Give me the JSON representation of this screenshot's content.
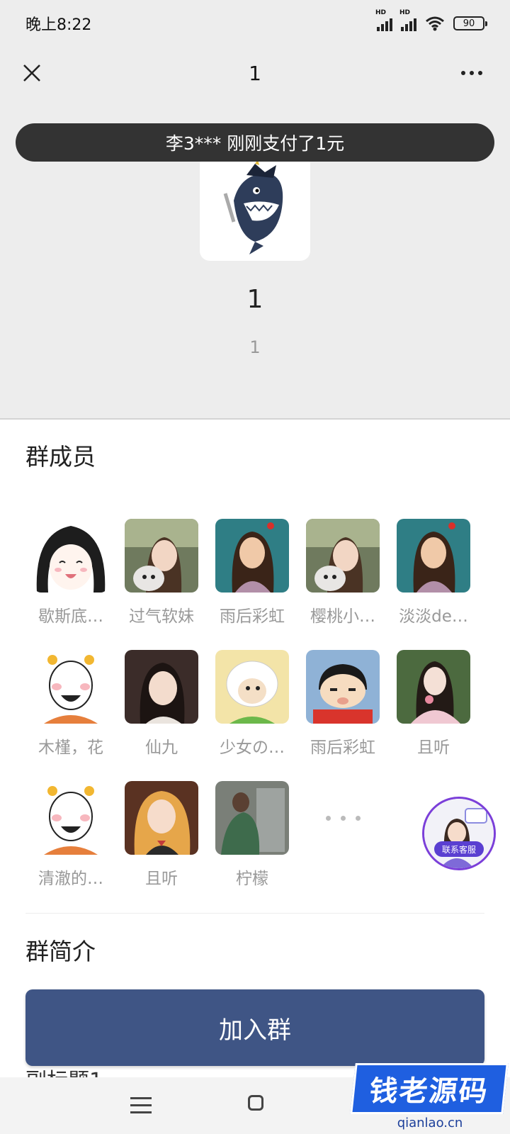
{
  "status_bar": {
    "time": "晚上8:22",
    "network_1": "HD",
    "network_2": "HD",
    "battery": "90"
  },
  "navbar": {
    "title": "1"
  },
  "toast": {
    "text": "李3*** 刚刚支付了1元"
  },
  "group": {
    "name": "1",
    "subtitle": "1"
  },
  "members_section": {
    "title": "群成员",
    "members": [
      {
        "name": "歇斯底…"
      },
      {
        "name": "过气软妹"
      },
      {
        "name": "雨后彩虹"
      },
      {
        "name": "樱桃小…"
      },
      {
        "name": "淡淡de…"
      },
      {
        "name": "木槿，花"
      },
      {
        "name": "仙九"
      },
      {
        "name": "少女の…"
      },
      {
        "name": "雨后彩虹"
      },
      {
        "name": "且听"
      },
      {
        "name": "清澈的…"
      },
      {
        "name": "且听"
      },
      {
        "name": "柠檬"
      }
    ]
  },
  "intro_section": {
    "title": "群简介",
    "peek_text": "副标题1"
  },
  "customer_service": {
    "label": "联系客服"
  },
  "join_button": {
    "label": "加入群"
  },
  "watermark": {
    "text": "钱老源码",
    "url": "qianlao.cn"
  },
  "colors": {
    "join_button": "#3f5585",
    "toast_bg": "#333333",
    "service_ring": "#7b3fd9",
    "watermark_bg": "#1f5fe0"
  }
}
